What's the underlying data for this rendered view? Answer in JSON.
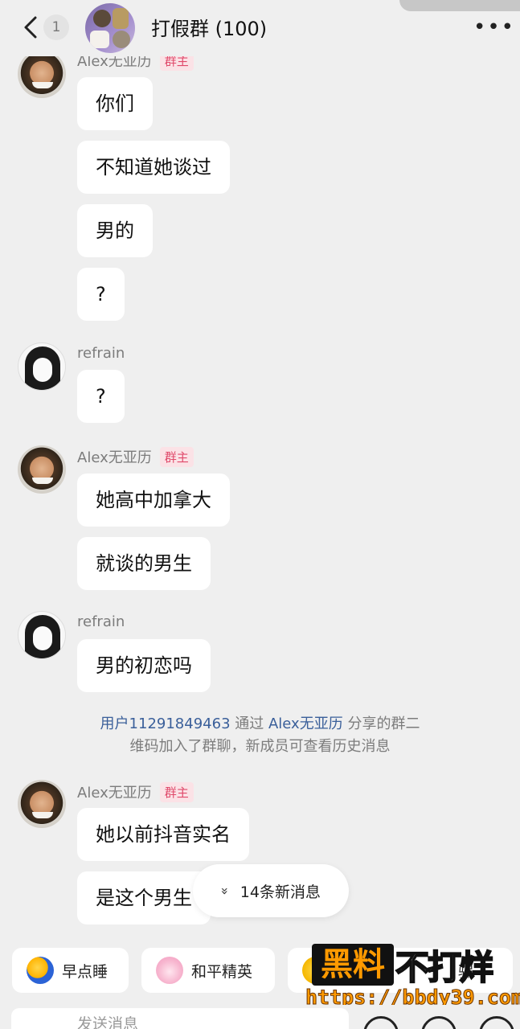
{
  "header": {
    "unread_count": "1",
    "title": "打假群 (100)",
    "more": "•••"
  },
  "messages": [
    {
      "sender": "Alex无亚历",
      "badge": "群主",
      "bubbles": [
        "你们",
        "不知道她谈过",
        "男的",
        "?"
      ]
    },
    {
      "sender": "refrain",
      "bubbles": [
        "?"
      ]
    },
    {
      "sender": "Alex无亚历",
      "badge": "群主",
      "bubbles": [
        "她高中加拿大",
        "就谈的男生"
      ]
    },
    {
      "sender": "refrain",
      "bubbles": [
        "男的初恋吗"
      ]
    },
    {
      "sender": "Alex无亚历",
      "badge": "群主",
      "bubbles": [
        "她以前抖音实名",
        "是这个男生"
      ]
    }
  ],
  "system_notice": {
    "user": "用户11291849463",
    "via": " 通过 ",
    "sharer": "Alex无亚历",
    "rest1": " 分享的群二",
    "rest2": "维码加入了群聊，新成员可查看历史消息"
  },
  "new_messages_pill": {
    "chevron": "»",
    "label": "14条新消息"
  },
  "quick_replies": [
    "早点睡",
    "和平精英",
    "骗"
  ],
  "watermark": {
    "black_text": "黑料",
    "white_text": "不打烊",
    "url": "https://bbdy39.com"
  },
  "input": {
    "placeholder": "发送消息"
  }
}
